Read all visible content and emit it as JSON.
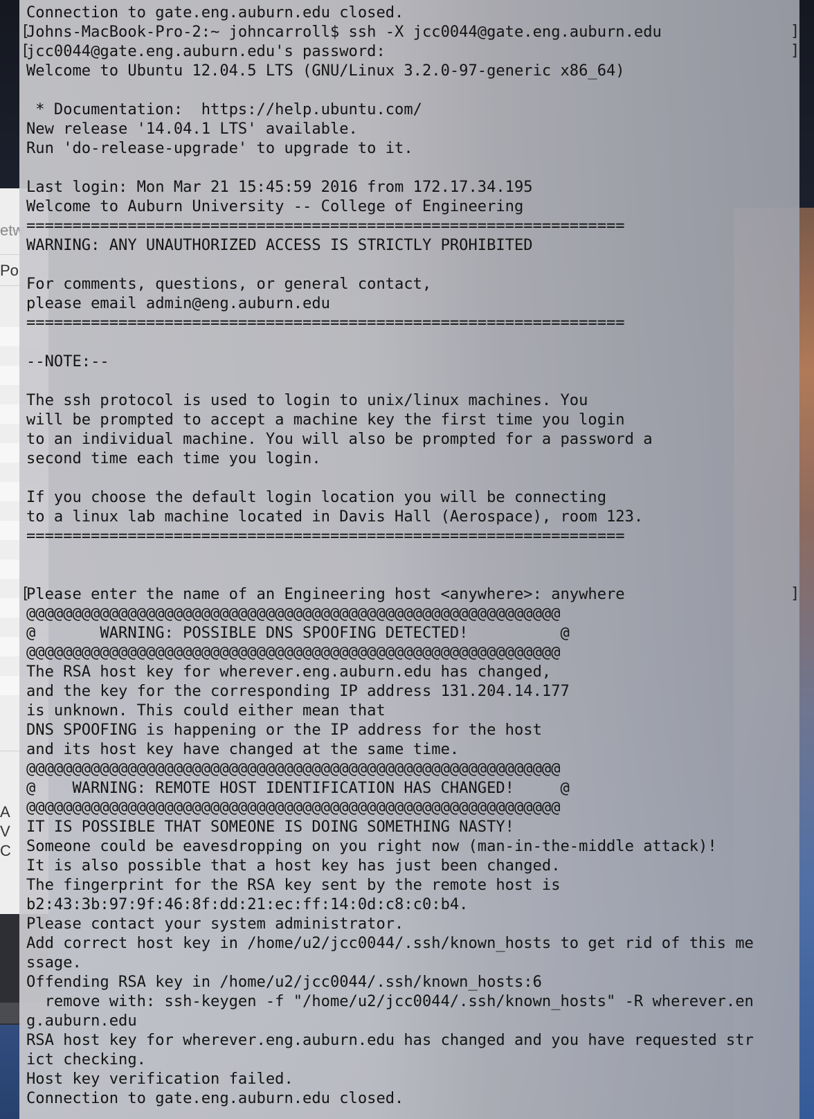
{
  "background_window": {
    "fragments": [
      "etw",
      "Po",
      "A",
      "V",
      "C"
    ]
  },
  "terminal": {
    "lines": [
      "Connection to gate.eng.auburn.edu closed.",
      "Johns-MacBook-Pro-2:~ johncarroll$ ssh -X jcc0044@gate.eng.auburn.edu",
      "jcc0044@gate.eng.auburn.edu's password:",
      "Welcome to Ubuntu 12.04.5 LTS (GNU/Linux 3.2.0-97-generic x86_64)",
      "",
      " * Documentation:  https://help.ubuntu.com/",
      "New release '14.04.1 LTS' available.",
      "Run 'do-release-upgrade' to upgrade to it.",
      "",
      "Last login: Mon Mar 21 15:45:59 2016 from 172.17.34.195",
      "Welcome to Auburn University -- College of Engineering",
      "=================================================================",
      "WARNING: ANY UNAUTHORIZED ACCESS IS STRICTLY PROHIBITED",
      "",
      "For comments, questions, or general contact,",
      "please email admin@eng.auburn.edu",
      "=================================================================",
      "",
      "--NOTE:--",
      "",
      "The ssh protocol is used to login to unix/linux machines. You",
      "will be prompted to accept a machine key the first time you login",
      "to an individual machine. You will also be prompted for a password a",
      "second time each time you login.",
      "",
      "If you choose the default login location you will be connecting",
      "to a linux lab machine located in Davis Hall (Aerospace), room 123.",
      "=================================================================",
      "",
      "",
      "Please enter the name of an Engineering host <anywhere>: anywhere",
      "@@@@@@@@@@@@@@@@@@@@@@@@@@@@@@@@@@@@@@@@@@@@@@@@@@@@@@@@@@",
      "@       WARNING: POSSIBLE DNS SPOOFING DETECTED!          @",
      "@@@@@@@@@@@@@@@@@@@@@@@@@@@@@@@@@@@@@@@@@@@@@@@@@@@@@@@@@@",
      "The RSA host key for wherever.eng.auburn.edu has changed,",
      "and the key for the corresponding IP address 131.204.14.177",
      "is unknown. This could either mean that",
      "DNS SPOOFING is happening or the IP address for the host",
      "and its host key have changed at the same time.",
      "@@@@@@@@@@@@@@@@@@@@@@@@@@@@@@@@@@@@@@@@@@@@@@@@@@@@@@@@@@",
      "@    WARNING: REMOTE HOST IDENTIFICATION HAS CHANGED!     @",
      "@@@@@@@@@@@@@@@@@@@@@@@@@@@@@@@@@@@@@@@@@@@@@@@@@@@@@@@@@@",
      "IT IS POSSIBLE THAT SOMEONE IS DOING SOMETHING NASTY!",
      "Someone could be eavesdropping on you right now (man-in-the-middle attack)!",
      "It is also possible that a host key has just been changed.",
      "The fingerprint for the RSA key sent by the remote host is",
      "b2:43:3b:97:9f:46:8f:dd:21:ec:ff:14:0d:c8:c0:b4.",
      "Please contact your system administrator.",
      "Add correct host key in /home/u2/jcc0044/.ssh/known_hosts to get rid of this me",
      "ssage.",
      "Offending RSA key in /home/u2/jcc0044/.ssh/known_hosts:6",
      "  remove with: ssh-keygen -f \"/home/u2/jcc0044/.ssh/known_hosts\" -R wherever.en",
      "g.auburn.edu",
      "RSA host key for wherever.eng.auburn.edu has changed and you have requested str",
      "ict checking.",
      "Host key verification failed.",
      "Connection to gate.eng.auburn.edu closed."
    ]
  }
}
